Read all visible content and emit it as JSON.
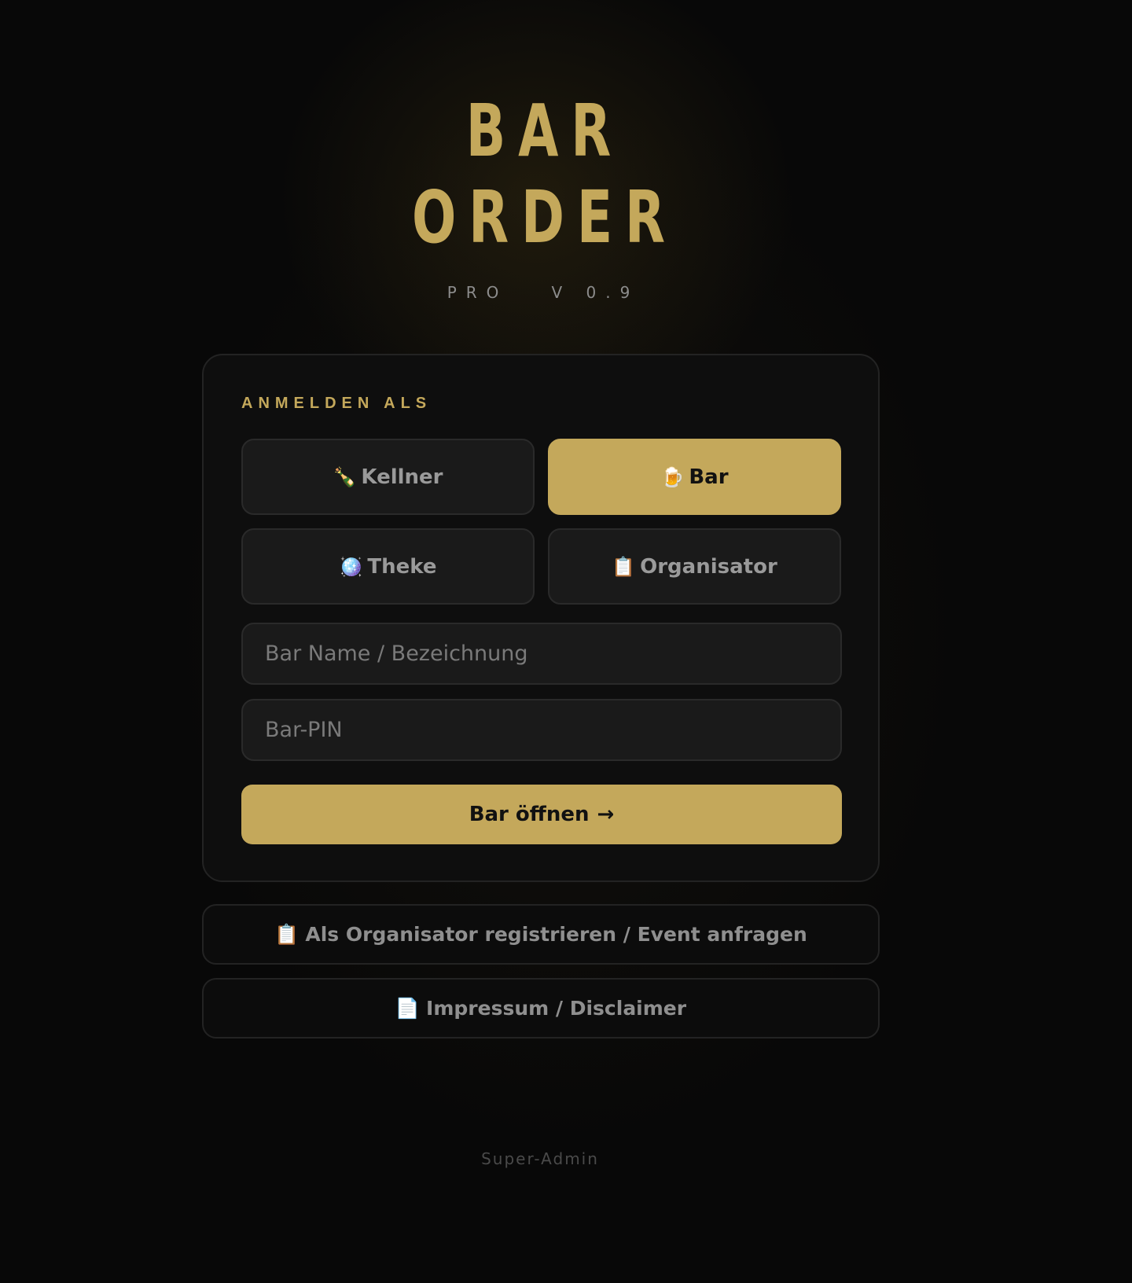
{
  "logo": {
    "line1": "BAR",
    "line2": "ORDER",
    "subtitle": "PRO   V 0.9"
  },
  "login": {
    "section_label": "ANMELDEN ALS",
    "roles": [
      {
        "icon": "🍾",
        "icon_name": "champagne-bottle-icon",
        "label": "Kellner",
        "active": false
      },
      {
        "icon": "🍺",
        "icon_name": "beer-mug-icon",
        "label": "Bar",
        "active": true
      },
      {
        "icon": "🪩",
        "icon_name": "disco-ball-icon",
        "label": "Theke",
        "active": false
      },
      {
        "icon": "📋",
        "icon_name": "clipboard-icon",
        "label": "Organisator",
        "active": false
      }
    ],
    "name_field": {
      "placeholder": "Bar Name / Bezeichnung",
      "value": ""
    },
    "pin_field": {
      "placeholder": "Bar-PIN",
      "value": ""
    },
    "submit_label": "Bar öffnen",
    "submit_arrow": "→"
  },
  "links": {
    "register": {
      "icon": "📋",
      "label": "Als Organisator registrieren / Event anfragen"
    },
    "impressum": {
      "icon": "📄",
      "label": "Impressum / Disclaimer"
    }
  },
  "footer": {
    "admin_label": "Super-Admin"
  },
  "colors": {
    "accent": "#c4a85b",
    "background": "#080808",
    "card": "#0e0e0e",
    "field": "#1a1a1a"
  }
}
